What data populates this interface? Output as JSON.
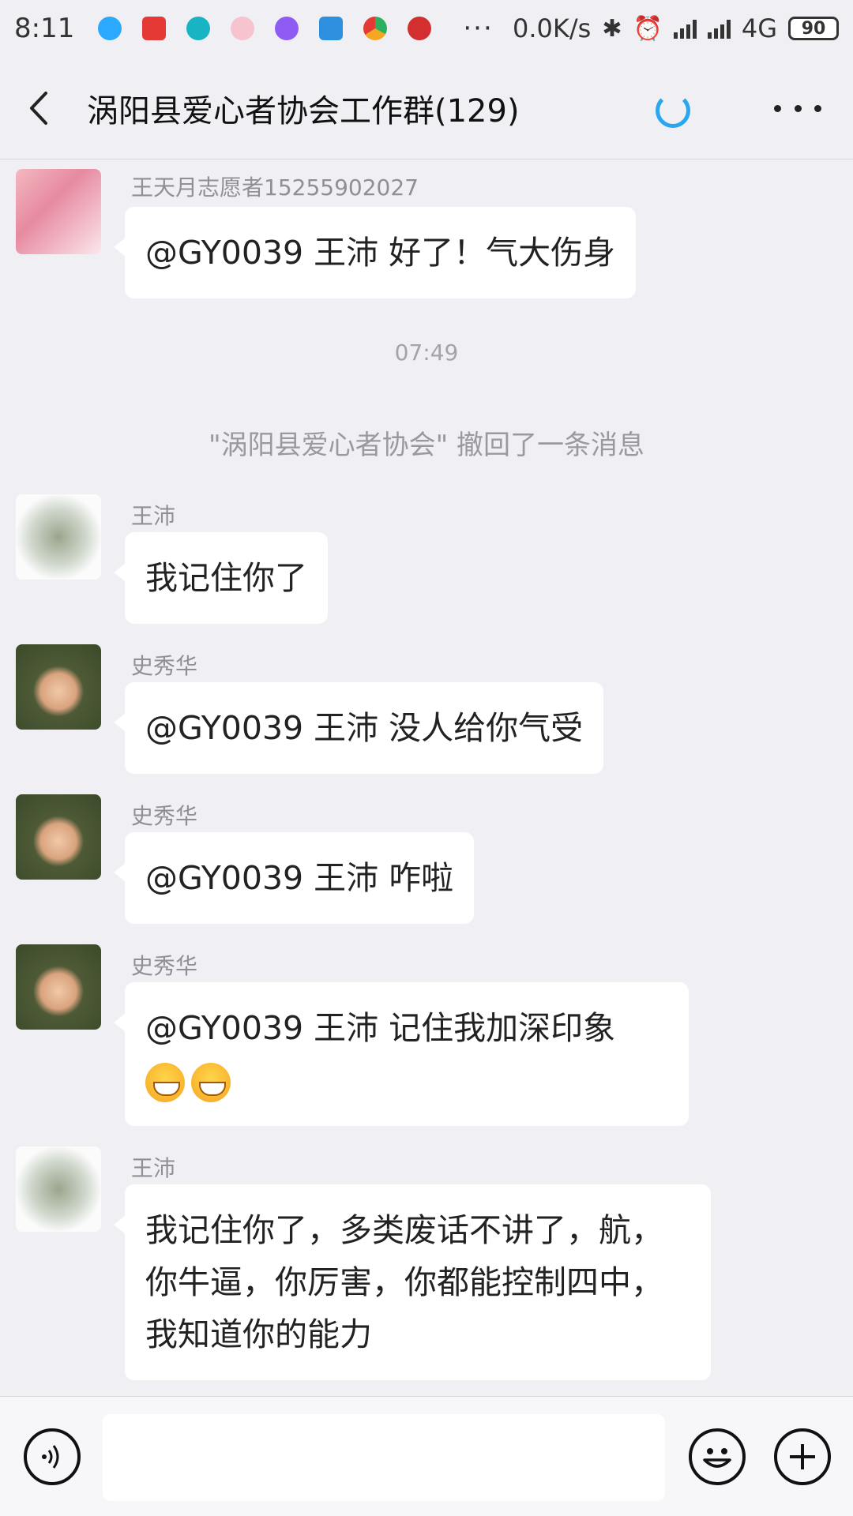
{
  "status_bar": {
    "time": "8:11",
    "network_speed": "0.0K/s",
    "network_type": "4G",
    "battery": "90",
    "app_icons": [
      {
        "name": "qq-icon",
        "color": "#2aa9ff"
      },
      {
        "name": "toutiao-icon",
        "color": "#e53935"
      },
      {
        "name": "globe-icon",
        "color": "#19b4c4"
      },
      {
        "name": "app-icon",
        "color": "#e24c6a"
      },
      {
        "name": "play-icon",
        "color": "#8e5cf5"
      },
      {
        "name": "bird-icon",
        "color": "#2f8fdf"
      },
      {
        "name": "color-circle-icon",
        "color": "#2bb15d"
      },
      {
        "name": "red-app-icon",
        "color": "#d32f2f"
      }
    ]
  },
  "header": {
    "title": "涡阳县爱心者协会工作群(129)",
    "accent": "#28a6ef"
  },
  "messages": [
    {
      "sender": "王天月志愿者15255902027",
      "text": "@GY0039 王沛  好了！气大伤身"
    },
    {
      "type": "time",
      "text": "07:49"
    },
    {
      "type": "system",
      "text": "\"涡阳县爱心者协会\" 撤回了一条消息"
    },
    {
      "sender": "王沛",
      "text": "我记住你了"
    },
    {
      "sender": "史秀华",
      "text": "@GY0039 王沛  没人给你气受"
    },
    {
      "sender": "史秀华",
      "text": "@GY0039 王沛  咋啦"
    },
    {
      "sender": "史秀华",
      "text": "@GY0039 王沛  记住我加深印象"
    },
    {
      "sender": "王沛",
      "text_lines": [
        "我记住你了，多类废话不讲了，航，",
        "你牛逼，你厉害，你都能控制四中，",
        "我知道你的能力"
      ]
    }
  ],
  "input": {
    "placeholder": "",
    "value": ""
  }
}
